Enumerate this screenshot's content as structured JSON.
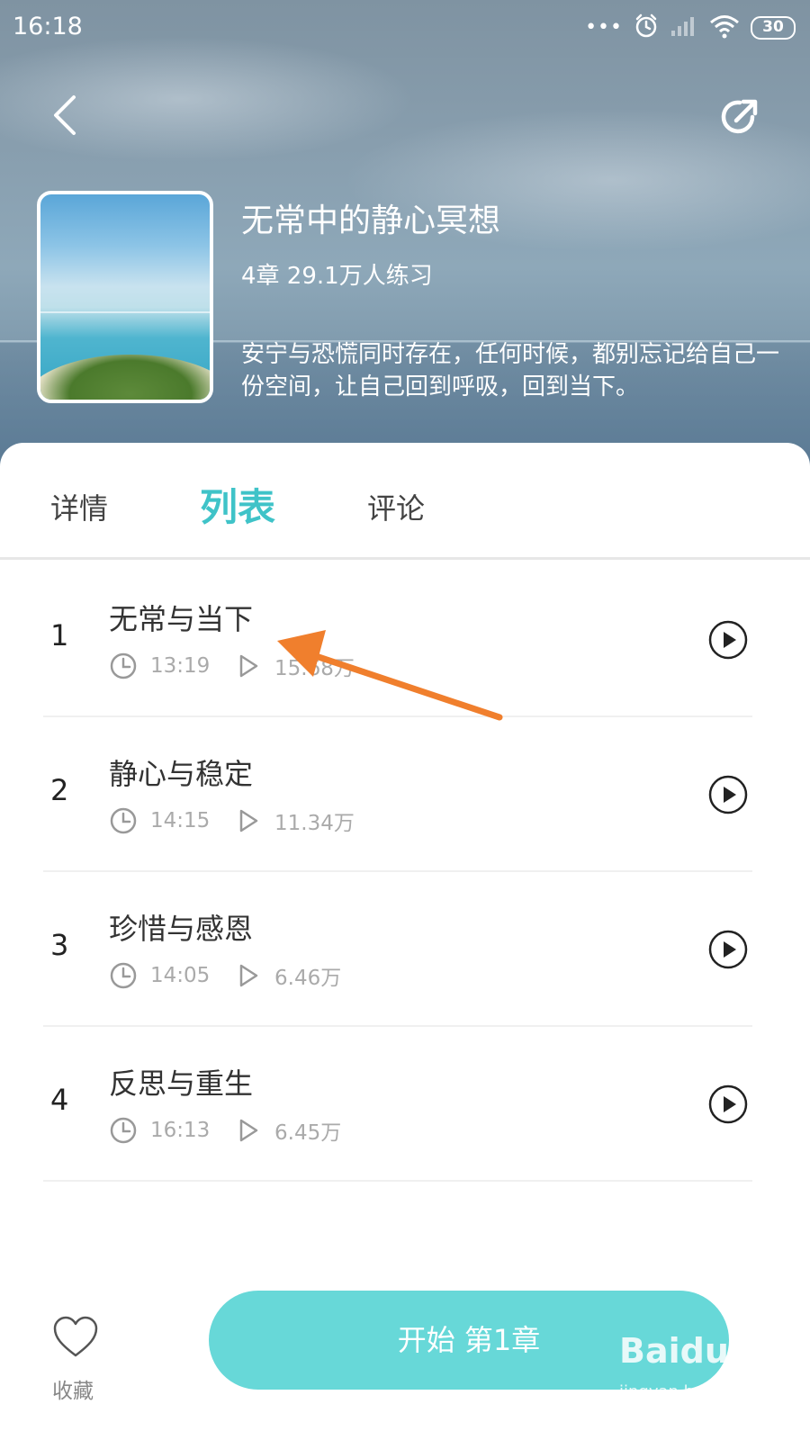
{
  "status_bar": {
    "time": "16:18",
    "dots": "•••",
    "battery": "30"
  },
  "course": {
    "title": "无常中的静心冥想",
    "meta": "4章 29.1万人练习",
    "description": "安宁与恐慌同时存在，任何时候，都别忘记给自己一份空间，让自己回到呼吸，回到当下。"
  },
  "tabs": [
    {
      "label": "详情",
      "active": false
    },
    {
      "label": "列表",
      "active": true
    },
    {
      "label": "评论",
      "active": false
    }
  ],
  "chapters": [
    {
      "number": "1",
      "title": "无常与当下",
      "duration": "13:19",
      "plays": "15.68万"
    },
    {
      "number": "2",
      "title": "静心与稳定",
      "duration": "14:15",
      "plays": "11.34万"
    },
    {
      "number": "3",
      "title": "珍惜与感恩",
      "duration": "14:05",
      "plays": "6.46万"
    },
    {
      "number": "4",
      "title": "反思与重生",
      "duration": "16:13",
      "plays": "6.45万"
    }
  ],
  "bottom": {
    "favorite_label": "收藏",
    "start_label": "开始 第1章"
  },
  "watermark": {
    "logo": "Baidu经验",
    "url": "jingyan.baidu.com"
  },
  "colors": {
    "accent": "#3fc3c8",
    "start_button": "#67d8d8",
    "annotation_arrow": "#f07f2d"
  },
  "icons": [
    "back-arrow-icon",
    "share-icon",
    "alarm-icon",
    "signal-icon",
    "wifi-icon",
    "clock-icon",
    "play-count-icon",
    "play-circle-icon",
    "heart-icon"
  ]
}
